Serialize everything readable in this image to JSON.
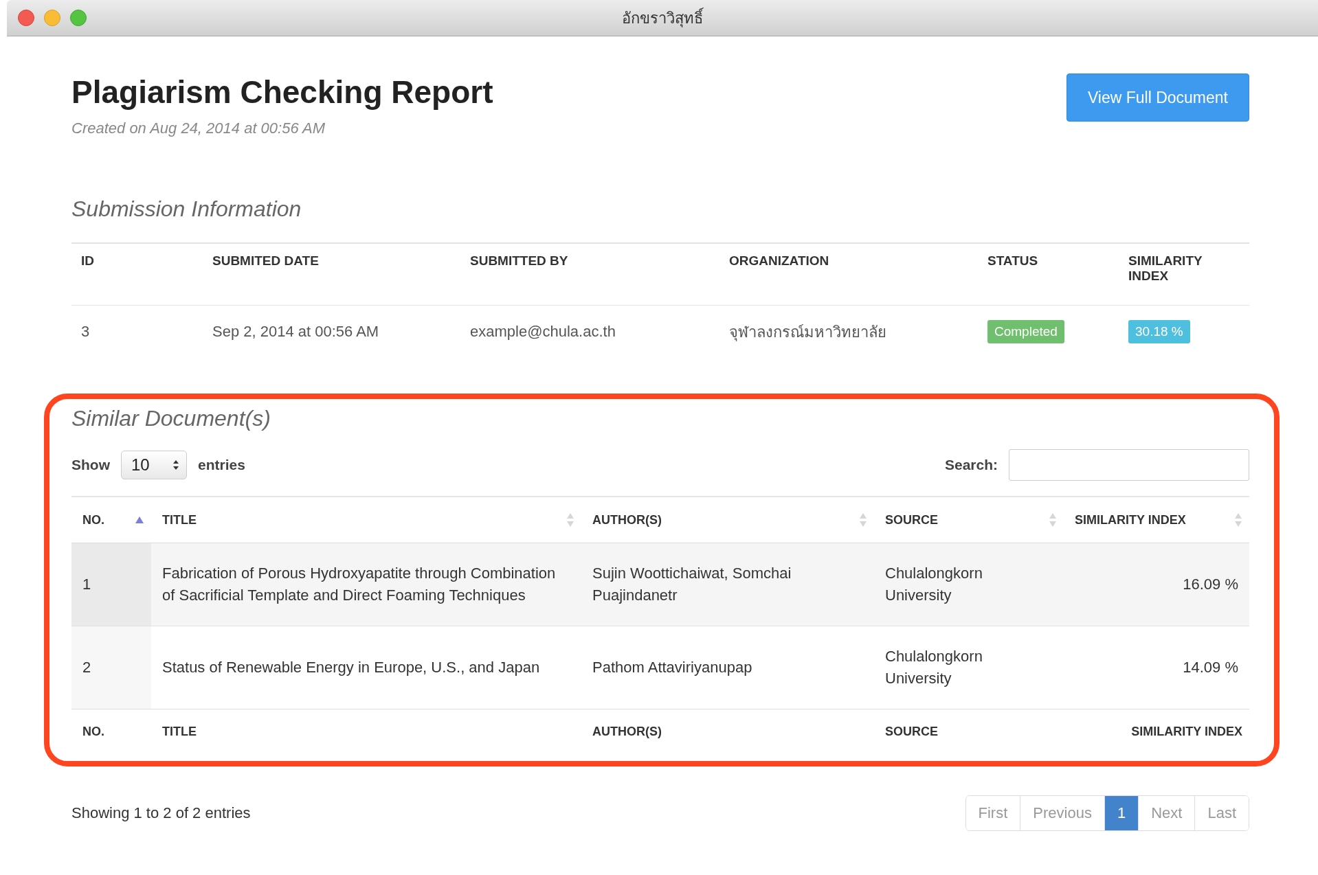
{
  "window": {
    "title": "อักขราวิสุทธิ์"
  },
  "header": {
    "title": "Plagiarism Checking Report",
    "created": "Created on Aug 24, 2014 at 00:56 AM",
    "button": "View Full Document"
  },
  "submission": {
    "heading": "Submission Information",
    "columns": [
      "ID",
      "SUBMITED DATE",
      "SUBMITTED BY",
      "ORGANIZATION",
      "STATUS",
      "SIMILARITY INDEX"
    ],
    "row": [
      {
        "kind": "text",
        "text": "3"
      },
      {
        "kind": "text",
        "text": "Sep 2, 2014 at 00:56 AM"
      },
      {
        "kind": "text",
        "text": "example@chula.ac.th"
      },
      {
        "kind": "text",
        "text": "จุฬาลงกรณ์มหาวิทยาลัย"
      },
      {
        "kind": "status",
        "text": "Completed"
      },
      {
        "kind": "percent",
        "text": "30.18 %"
      }
    ]
  },
  "similar": {
    "heading": "Similar Document(s)",
    "highlighted": true,
    "show_label": "Show",
    "page_size": "10",
    "entries_label": "entries",
    "search_label": "Search:",
    "columns": [
      {
        "label": "NO.",
        "sorted": true
      },
      {
        "label": "TITLE",
        "sorted": false
      },
      {
        "label": "AUTHOR(S)",
        "sorted": false
      },
      {
        "label": "SOURCE",
        "sorted": false
      },
      {
        "label": "SIMILARITY INDEX",
        "sorted": false
      }
    ],
    "rows": [
      [
        "1",
        "Fabrication of Porous Hydroxyapatite through Combination of Sacrificial Template and Direct Foaming Techniques",
        "Sujin Woottichaiwat, Somchai Puajindanetr",
        "Chulalongkorn University",
        "16.09 %"
      ],
      [
        "2",
        "Status of Renewable Energy in Europe, U.S., and Japan",
        "Pathom Attaviriyanupap",
        "Chulalongkorn University",
        "14.09 %"
      ]
    ],
    "footer_columns": [
      "NO.",
      "TITLE",
      "AUTHOR(S)",
      "SOURCE",
      "SIMILARITY INDEX"
    ]
  },
  "info": "Showing 1 to 2 of 2 entries",
  "pagination": [
    {
      "label": "First",
      "selected": false,
      "disabled": true
    },
    {
      "label": "Previous",
      "selected": false,
      "disabled": true
    },
    {
      "label": "1",
      "selected": true,
      "disabled": false
    },
    {
      "label": "Next",
      "selected": false,
      "disabled": true
    },
    {
      "label": "Last",
      "selected": false,
      "disabled": true
    }
  ]
}
